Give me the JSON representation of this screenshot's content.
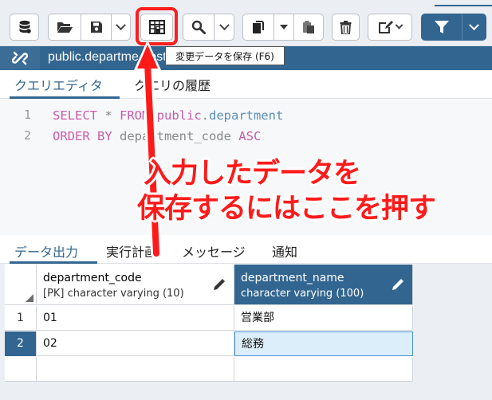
{
  "toolbar": {
    "buttons": [
      "database",
      "open-file",
      "save-file",
      "save-data",
      "find",
      "copy",
      "paste",
      "delete",
      "edit",
      "filter"
    ]
  },
  "connection": {
    "label": "public.departme...ostgreSQL 13"
  },
  "tooltip": {
    "text": "変更データを保存 (F6)"
  },
  "editor_tabs": {
    "query": "クエリエディタ",
    "history": "クエリの履歴"
  },
  "editor": {
    "line_numbers": [
      "1",
      "2"
    ],
    "lines": [
      {
        "kw1": "SELECT",
        "mid": " * ",
        "kw2": "FROM",
        "kw3": "public",
        "dot": ".",
        "ident": "department"
      },
      {
        "kw1": "ORDER BY",
        "mid": " department_code ",
        "kw2": "ASC"
      }
    ]
  },
  "result_tabs": {
    "data_output": "データ出力",
    "explain": "実行計画",
    "messages": "メッセージ",
    "notifications": "通知"
  },
  "grid": {
    "columns": [
      {
        "name": "department_code",
        "type": "[PK] character varying (10)"
      },
      {
        "name": "department_name",
        "type": "character varying (100)"
      }
    ],
    "rows": [
      {
        "num": "1",
        "code": "01",
        "name": "営業部"
      },
      {
        "num": "2",
        "code": "02",
        "name": "総務"
      }
    ]
  },
  "annotation": {
    "line1": "入力したデータを",
    "line2": "保存するにはここを押す",
    "color": "#ff1a1a"
  },
  "colors": {
    "accent": "#326690",
    "selected_cell": "#dbeefa"
  }
}
